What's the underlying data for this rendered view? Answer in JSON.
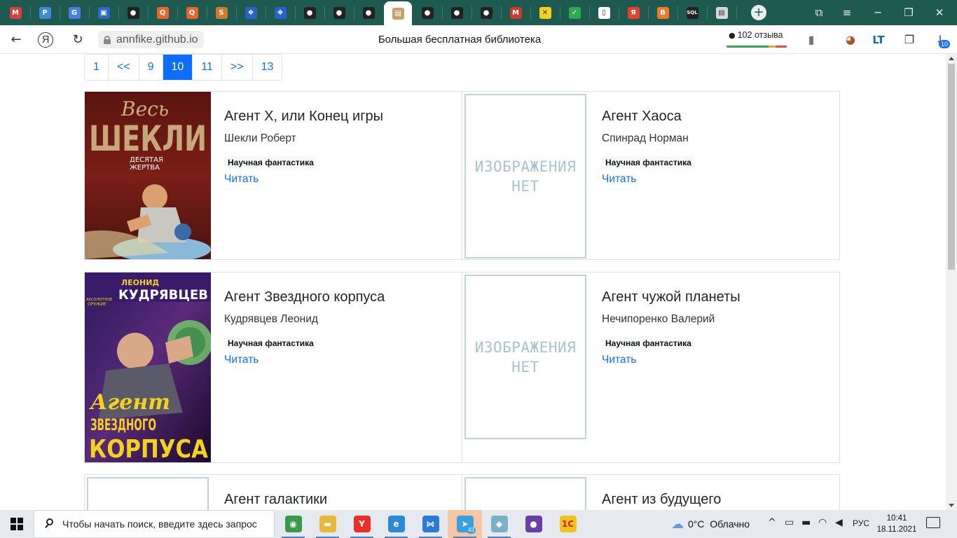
{
  "browser": {
    "url": "annfike.github.io",
    "page_title": "Большая бесплатная библиотека",
    "reviews_label": "102 отзыва",
    "downloads_badge": "10",
    "tabs": [
      {
        "icon": "mail-icon",
        "color": "#d94040",
        "glyph": "M"
      },
      {
        "icon": "translate-icon",
        "color": "#3a8bd8",
        "glyph": "P"
      },
      {
        "icon": "google-translate-icon",
        "color": "#4a7fe0",
        "glyph": "G"
      },
      {
        "icon": "chat-icon",
        "color": "#2b6cc4",
        "glyph": "▣"
      },
      {
        "icon": "github-icon",
        "color": "#222222",
        "glyph": "●"
      },
      {
        "icon": "q-icon",
        "color": "#e8662a",
        "glyph": "Q"
      },
      {
        "icon": "q-icon",
        "color": "#e8662a",
        "glyph": "Q"
      },
      {
        "icon": "s-icon",
        "color": "#d07a2a",
        "glyph": "S"
      },
      {
        "icon": "dropbox-icon",
        "color": "#2a62c8",
        "glyph": "❖"
      },
      {
        "icon": "dropbox-icon",
        "color": "#2a62c8",
        "glyph": "❖"
      },
      {
        "icon": "github-icon",
        "color": "#222222",
        "glyph": "●"
      },
      {
        "icon": "github-icon",
        "color": "#222222",
        "glyph": "●"
      },
      {
        "icon": "github-icon",
        "color": "#222222",
        "glyph": "●"
      },
      {
        "icon": "library-icon",
        "color": "#c9a06a",
        "glyph": "▤"
      },
      {
        "icon": "github-icon",
        "color": "#222222",
        "glyph": "●"
      },
      {
        "icon": "github-icon",
        "color": "#222222",
        "glyph": "●"
      },
      {
        "icon": "github-icon",
        "color": "#222222",
        "glyph": "●"
      },
      {
        "icon": "gmail-icon",
        "color": "#c93a2f",
        "glyph": "M"
      },
      {
        "icon": "x-icon",
        "color": "#f2d21f",
        "glyph": "✕"
      },
      {
        "icon": "check-icon",
        "color": "#2fa84f",
        "glyph": "✓"
      },
      {
        "icon": "document-icon",
        "color": "#ffffff",
        "glyph": "▯"
      },
      {
        "icon": "yandex-icon",
        "color": "#e8402a",
        "glyph": "Я"
      },
      {
        "icon": "blogger-icon",
        "color": "#ef7a2a",
        "glyph": "B"
      },
      {
        "icon": "sql-icon",
        "color": "#222222",
        "glyph": "SQL"
      },
      {
        "icon": "image-icon",
        "color": "#d8d8d8",
        "glyph": "▤"
      }
    ]
  },
  "pagination": {
    "pages": [
      {
        "label": "1",
        "active": false
      },
      {
        "label": "<<",
        "active": false
      },
      {
        "label": "9",
        "active": false
      },
      {
        "label": "10",
        "active": true
      },
      {
        "label": "11",
        "active": false
      },
      {
        "label": ">>",
        "active": false
      },
      {
        "label": "13",
        "active": false
      }
    ]
  },
  "no_image": {
    "line1": "ИЗОБРАЖЕНИЯ",
    "line2": "НЕТ"
  },
  "books": [
    {
      "title": "Агент Х, или Конец игры",
      "author": "Шекли Роберт",
      "genre": "Научная фантастика",
      "read": "Читать",
      "cover": "Весь ШЕКЛИ Десятая жертва",
      "has_cover": true
    },
    {
      "title": "Агент Хаоса",
      "author": "Спинрад Норман",
      "genre": "Научная фантастика",
      "read": "Читать",
      "has_cover": false
    },
    {
      "title": "Агент Звездного корпуса",
      "author": "Кудрявцев Леонид",
      "genre": "Научная фантастика",
      "read": "Читать",
      "cover": "ЛЕОНИД КУДРЯВЦЕВ Агент Звездного корпуса",
      "has_cover": true
    },
    {
      "title": "Агент чужой планеты",
      "author": "Нечипоренко Валерий",
      "genre": "Научная фантастика",
      "read": "Читать",
      "has_cover": false
    },
    {
      "title": "Агент галактики",
      "has_cover": false
    },
    {
      "title": "Агент из будущего",
      "has_cover": false
    }
  ],
  "covers": {
    "sheckley": {
      "top": "Весь",
      "name": "ШЕКЛИ",
      "sub1": "ДЕСЯТАЯ",
      "sub2": "ЖЕРТВА"
    },
    "kudryavtsev": {
      "first": "ЛЕОНИД",
      "last": "КУДРЯВЦЕВ",
      "series1": "АБСОЛЮТНОЕ",
      "series2": "ОРУЖИЕ",
      "t1": "Агент",
      "t2": "ЗВЕЗДНОГО",
      "t3": "КОРПУСА"
    }
  },
  "taskbar": {
    "search_placeholder": "Чтобы начать поиск, введите здесь запрос",
    "weather": "0°C  Облачно",
    "lang": "РУС",
    "time": "10:41",
    "date": "18.11.2021",
    "telegram_badge": "43",
    "apps": [
      {
        "icon": "chrome-icon",
        "color": "#3a9a4a",
        "glyph": "◉"
      },
      {
        "icon": "file-explorer-icon",
        "color": "#e9b73a",
        "glyph": "▬"
      },
      {
        "icon": "yandex-browser-icon",
        "color": "#e8302a",
        "glyph": "Y"
      },
      {
        "icon": "internet-explorer-icon",
        "color": "#2a8ad8",
        "glyph": "e"
      },
      {
        "icon": "vscode-icon",
        "color": "#2a7ad8",
        "glyph": "⋈"
      },
      {
        "icon": "telegram-icon",
        "color": "#3aa0e0",
        "glyph": "➤"
      },
      {
        "icon": "app-icon",
        "color": "#7ab0c8",
        "glyph": "◆"
      },
      {
        "icon": "github-desktop-icon",
        "color": "#6a3fa8",
        "glyph": "●"
      },
      {
        "icon": "1c-icon",
        "color": "#f2c21f",
        "glyph": "1С"
      }
    ]
  }
}
